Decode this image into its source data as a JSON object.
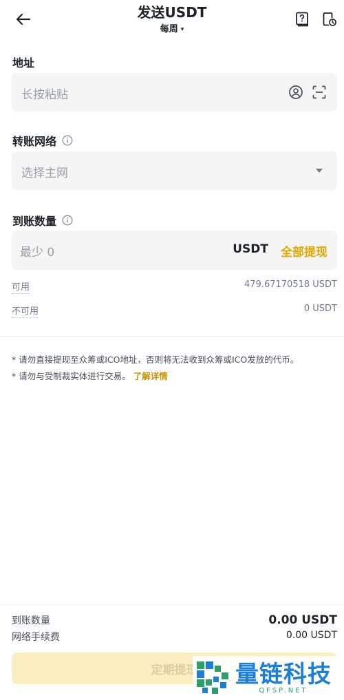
{
  "header": {
    "title": "发送USDT",
    "subtitle": "每周",
    "subtitle_caret": "▾"
  },
  "address": {
    "label": "地址",
    "placeholder": "长按粘贴"
  },
  "network": {
    "label": "转账网络",
    "placeholder": "选择主网"
  },
  "amount": {
    "label": "到账数量",
    "placeholder": "最少 0",
    "unit": "USDT",
    "all_label": "全部提现"
  },
  "balances": {
    "available_label": "可用",
    "available_value": "479.67170518 USDT",
    "unavailable_label": "不可用",
    "unavailable_value": "0 USDT"
  },
  "notes": {
    "line1": "* 请勿直接提现至众筹或ICO地址，否则将无法收到众筹或ICO发放的代币。",
    "line2": "* 请勿与受制裁实体进行交易。",
    "line2_link": "了解详情"
  },
  "summary": {
    "receive_label": "到账数量",
    "receive_value": "0.00 USDT",
    "fee_label": "网络手续费",
    "fee_value": "0.00 USDT"
  },
  "submit_label": "定期提现",
  "watermark": {
    "cn": "量链科技",
    "en": "QFSP.NET"
  },
  "colors": {
    "accent": "#e0a800",
    "button_disabled_bg": "#fcefbf",
    "field_bg": "#f5f5f5"
  }
}
